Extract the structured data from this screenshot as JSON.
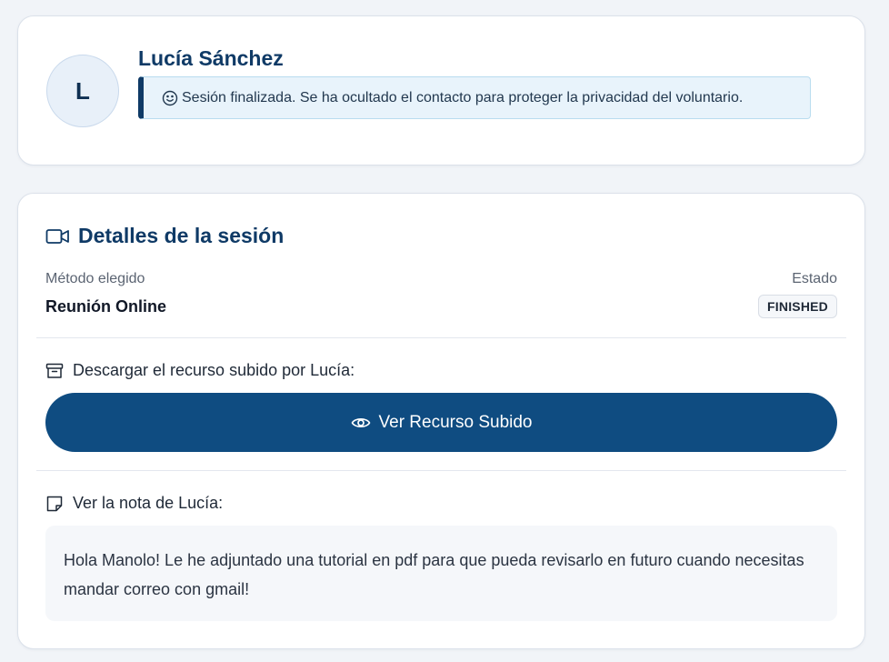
{
  "profile": {
    "avatar_initial": "L",
    "name": "Lucía Sánchez",
    "notice": "Sesión finalizada. Se ha ocultado el contacto para proteger la privacidad del voluntario."
  },
  "session": {
    "title": "Detalles de la sesión",
    "method_label": "Método elegido",
    "method_value": "Reunión Online",
    "status_label": "Estado",
    "status_value": "FINISHED",
    "download_label": "Descargar el recurso subido por Lucía:",
    "view_button": "Ver Recurso Subido",
    "note_label": "Ver la nota de Lucía:",
    "note_text": "Hola Manolo! Le he adjuntado una tutorial en pdf para que pueda revisarlo en futuro cuando necesitas mandar correo con gmail!"
  },
  "icons": {
    "notice": "smile-icon",
    "section": "video-camera-icon",
    "download": "archive-box-icon",
    "button": "eye-icon",
    "note": "sticky-note-icon"
  },
  "colors": {
    "primary": "#0f4c81",
    "heading": "#0f3a66",
    "notice_bg": "#e8f3fb",
    "notice_border": "#b9dcef"
  }
}
